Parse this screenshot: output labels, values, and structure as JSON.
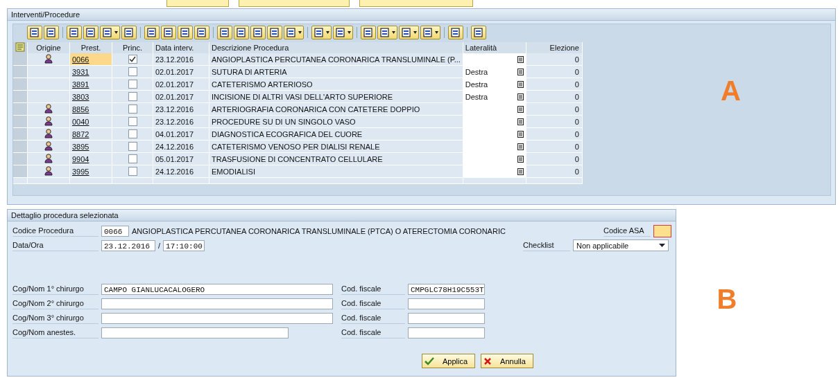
{
  "list_panel": {
    "title": "Interventi/Procedure",
    "annotation": "A",
    "columns": [
      "Origine",
      "Prest.",
      "Princ.",
      "Data interv.",
      "Descrizione Procedura",
      "Lateralità",
      "Elezione"
    ],
    "rows": [
      {
        "origin_person": true,
        "code": "0066",
        "selected": true,
        "main": true,
        "date": "23.12.2016",
        "description": "ANGIOPLASTICA PERCUTANEA CORONARICA TRANSLUMINALE (P...",
        "election": "0"
      },
      {
        "origin_person": false,
        "code": "3931",
        "selected": false,
        "main": false,
        "date": "02.01.2017",
        "description": "SUTURA DI ARTERIA",
        "laterality": "Destra",
        "election": "0"
      },
      {
        "origin_person": false,
        "code": "3891",
        "selected": false,
        "main": false,
        "date": "02.01.2017",
        "description": "CATETERISMO ARTERIOSO",
        "laterality": "Destra",
        "election": "0"
      },
      {
        "origin_person": false,
        "code": "3803",
        "selected": false,
        "main": false,
        "date": "02.01.2017",
        "description": "INCISIONE DI ALTRI VASI DELL'ARTO SUPERIORE",
        "laterality": "Destra",
        "election": "0"
      },
      {
        "origin_person": true,
        "code": "8856",
        "selected": false,
        "main": false,
        "date": "23.12.2016",
        "description": "ARTERIOGRAFIA CORONARICA CON CATETERE DOPPIO",
        "election": "0"
      },
      {
        "origin_person": true,
        "code": "0040",
        "selected": false,
        "main": false,
        "date": "23.12.2016",
        "description": "PROCEDURE SU DI UN SINGOLO VASO",
        "election": "0"
      },
      {
        "origin_person": true,
        "code": "8872",
        "selected": false,
        "main": false,
        "date": "04.01.2017",
        "description": "DIAGNOSTICA ECOGRAFICA DEL CUORE",
        "election": "0"
      },
      {
        "origin_person": true,
        "code": "3895",
        "selected": false,
        "main": false,
        "date": "24.12.2016",
        "description": "CATETERISMO VENOSO PER DIALISI RENALE",
        "election": "0"
      },
      {
        "origin_person": true,
        "code": "9904",
        "selected": false,
        "main": false,
        "date": "05.01.2017",
        "description": "TRASFUSIONE DI CONCENTRATO CELLULARE",
        "election": "0"
      },
      {
        "origin_person": true,
        "code": "3995",
        "selected": false,
        "main": false,
        "date": "24.12.2016",
        "description": "EMODIALISI",
        "election": "0"
      }
    ]
  },
  "detail_panel": {
    "title": "Dettaglio procedura selezionata",
    "annotation": "B",
    "procedure_label": "Codice Procedura",
    "procedure_code": "0066",
    "procedure_text": "ANGIOPLASTICA PERCUTANEA CORONARICA TRANSLUMINALE (PTCA) O ATERECTOMIA CORONARIC",
    "datetime_label": "Data/Ora",
    "date": "23.12.2016",
    "separator": "/",
    "time": "17:10:00",
    "asa_label": "Codice ASA",
    "asa_required": true,
    "checklist_label": "Checklist",
    "checklist_value": "Non applicabile",
    "people": [
      {
        "label": "Cog/Nom 1° chirurgo",
        "name": "CAMPO GIANLUCACALOGERO",
        "fiscal_label": "Cod. fiscale",
        "fiscal_code": "CMPGLC78H19C553T",
        "kind": "long"
      },
      {
        "label": "Cog/Nom 2° chirurgo",
        "fiscal_label": "Cod. fiscale",
        "kind": "long"
      },
      {
        "label": "Cog/Nom 3° chirurgo",
        "fiscal_label": "Cod. fiscale",
        "kind": "long"
      },
      {
        "label": "Cog/Nom  anestes.",
        "fiscal_label": "Cod. fiscale",
        "kind": "short"
      }
    ],
    "buttons": [
      "Applica",
      "Annulla"
    ]
  }
}
